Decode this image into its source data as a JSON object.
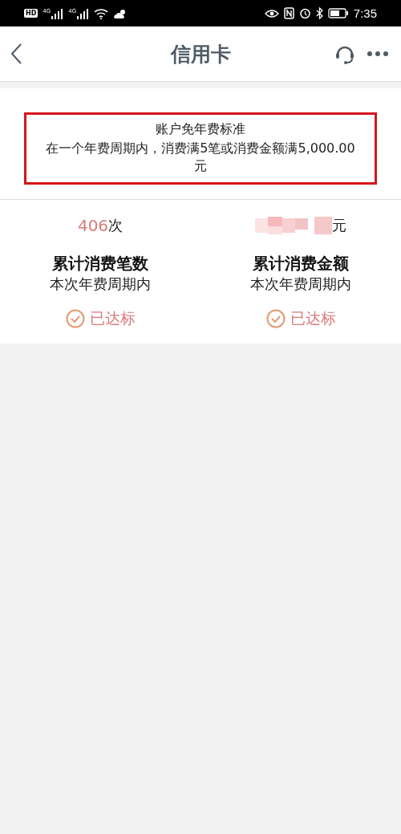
{
  "status_bar": {
    "hd": "HD",
    "networks": [
      "4G",
      "4G"
    ],
    "time": "7:35"
  },
  "nav": {
    "title": "信用卡"
  },
  "notice": {
    "title": "账户免年费标准",
    "body": "在一个年费周期内，消费满5笔或消费金额满5,000.00元",
    "highlighted": true
  },
  "stats": [
    {
      "value": "406",
      "value_hidden": false,
      "unit": "次",
      "label": "累计消费笔数",
      "period": "本次年费周期内",
      "status": "已达标",
      "achieved": true
    },
    {
      "value_hidden": true,
      "unit": "元",
      "label": "累计消费金额",
      "period": "本次年费周期内",
      "status": "已达标",
      "achieved": true
    }
  ]
}
